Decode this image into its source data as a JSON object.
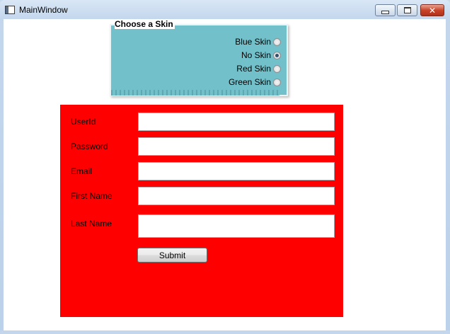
{
  "window": {
    "title": "MainWindow",
    "controls": {
      "minimize_icon": "minimize-icon",
      "maximize_icon": "maximize-icon",
      "close_icon": "close-icon",
      "close_glyph": "✕"
    }
  },
  "skin_chooser": {
    "header": "Choose a Skin",
    "background_color": "#72c1ca",
    "options": [
      {
        "label": "Blue Skin",
        "checked": false
      },
      {
        "label": "No Skin",
        "checked": true
      },
      {
        "label": "Red Skin",
        "checked": false
      },
      {
        "label": "Green Skin",
        "checked": false
      }
    ]
  },
  "form": {
    "background_color": "#ff0000",
    "fields": [
      {
        "label": "UserId",
        "value": ""
      },
      {
        "label": "Password",
        "value": ""
      },
      {
        "label": "Email",
        "value": ""
      },
      {
        "label": "First Name",
        "value": ""
      },
      {
        "label": "Last Name",
        "value": ""
      }
    ],
    "submit_label": "Submit"
  }
}
